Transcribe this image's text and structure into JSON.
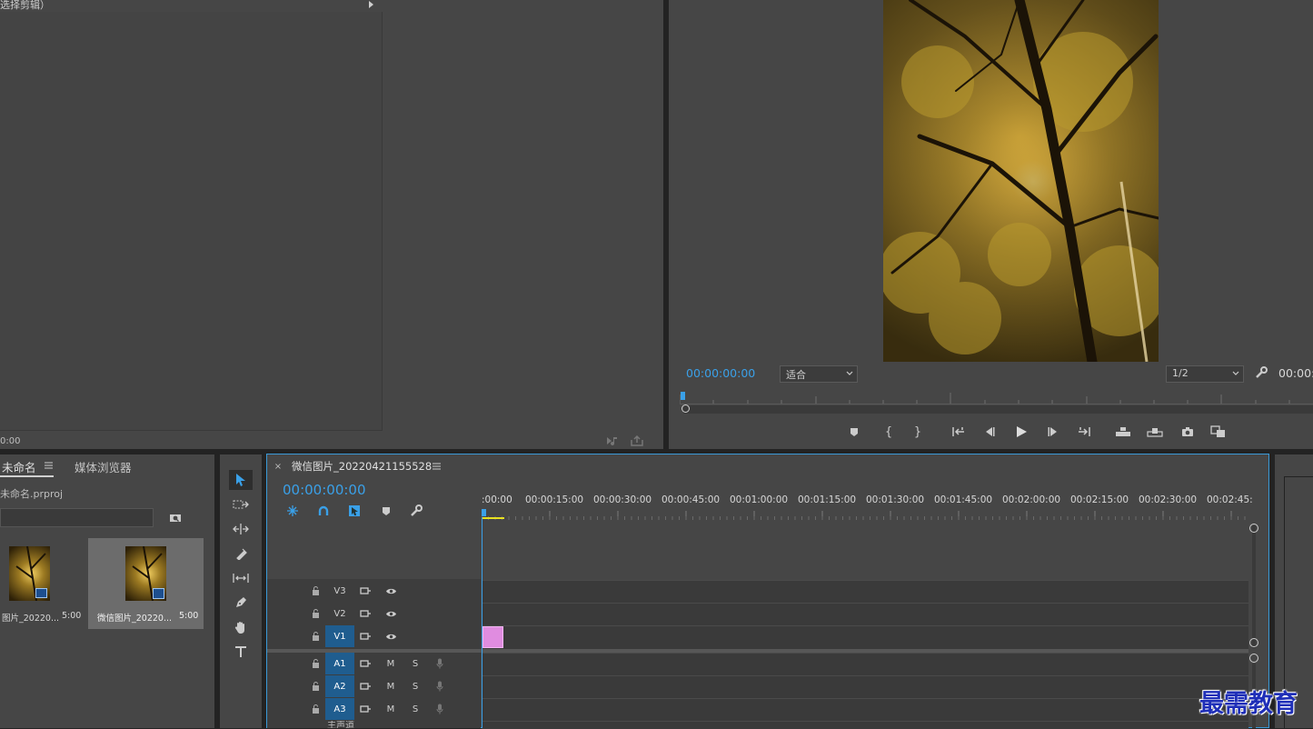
{
  "source_monitor": {
    "header_text": "选择剪辑）",
    "timecode_left": "0:00"
  },
  "program_monitor": {
    "timecode": "00:00:00:00",
    "fit_value": "适合",
    "resolution_value": "1/2",
    "timecode_right": "00:00:"
  },
  "project_panel": {
    "tab_project": "未命名",
    "tab_media_browser": "媒体浏览器",
    "project_file": "未命名.prproj",
    "items": [
      {
        "name": "图片_20220...",
        "duration": "5:00"
      },
      {
        "name": "微信图片_20220...",
        "duration": "5:00"
      }
    ]
  },
  "timeline": {
    "sequence_name": "微信图片_20220421155528",
    "timecode": "00:00:00:00",
    "ruler_labels": [
      ":00:00",
      "00:00:15:00",
      "00:00:30:00",
      "00:00:45:00",
      "00:01:00:00",
      "00:01:15:00",
      "00:01:30:00",
      "00:01:45:00",
      "00:02:00:00",
      "00:02:15:00",
      "00:02:30:00",
      "00:02:45:"
    ],
    "video_tracks": [
      "V3",
      "V2",
      "V1"
    ],
    "audio_tracks": [
      "A1",
      "A2",
      "A3"
    ],
    "audio_mute": "M",
    "audio_solo": "S",
    "master_partial": "主声道"
  },
  "watermark": "最需教育",
  "colors": {
    "accent": "#3aa0e8",
    "clip": "#e08ce0",
    "watermark": "#1f2fb8"
  }
}
